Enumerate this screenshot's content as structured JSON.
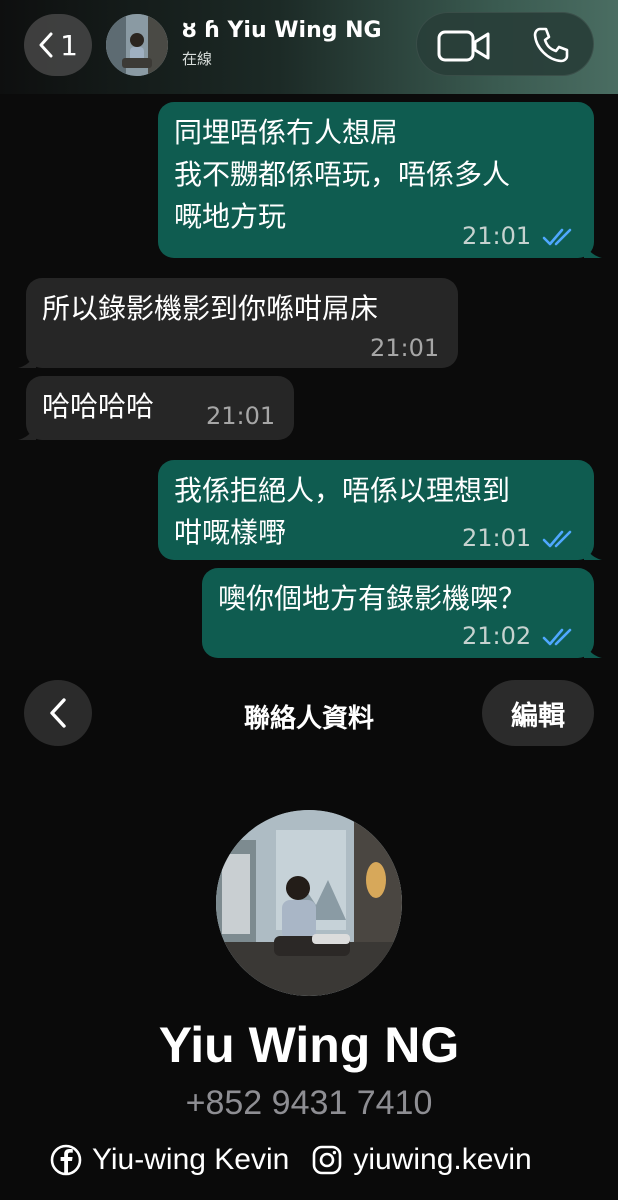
{
  "header": {
    "back_count": "1",
    "contact_name": "ȣ ɦ Yiu Wing NG",
    "status": "在線"
  },
  "messages": [
    {
      "direction": "out",
      "text": "同埋唔係冇人想屌\n我不嬲都係唔玩，唔係多人\n嘅地方玩",
      "time": "21:01",
      "read": true
    },
    {
      "direction": "in",
      "text": "所以錄影機影到你喺咁屌床",
      "time": "21:01"
    },
    {
      "direction": "in",
      "text": "哈哈哈哈",
      "time": "21:01"
    },
    {
      "direction": "out",
      "text": "我係拒絕人，唔係以理想到\n咁嘅樣嘢",
      "time": "21:01",
      "read": true
    },
    {
      "direction": "out",
      "text": "噢你個地方有錄影機㗎？",
      "time": "21:02",
      "read": true
    }
  ],
  "contact_info": {
    "title": "聯絡人資料",
    "edit_label": "編輯",
    "name": "Yiu Wing NG",
    "phone": "+852 9431 7410",
    "facebook": "Yiu-wing Kevin",
    "instagram": "yiuwing.kevin"
  },
  "colors": {
    "outgoing_bubble": "#0f5c50",
    "incoming_bubble": "#262626",
    "read_ticks": "#4fa8ff"
  }
}
